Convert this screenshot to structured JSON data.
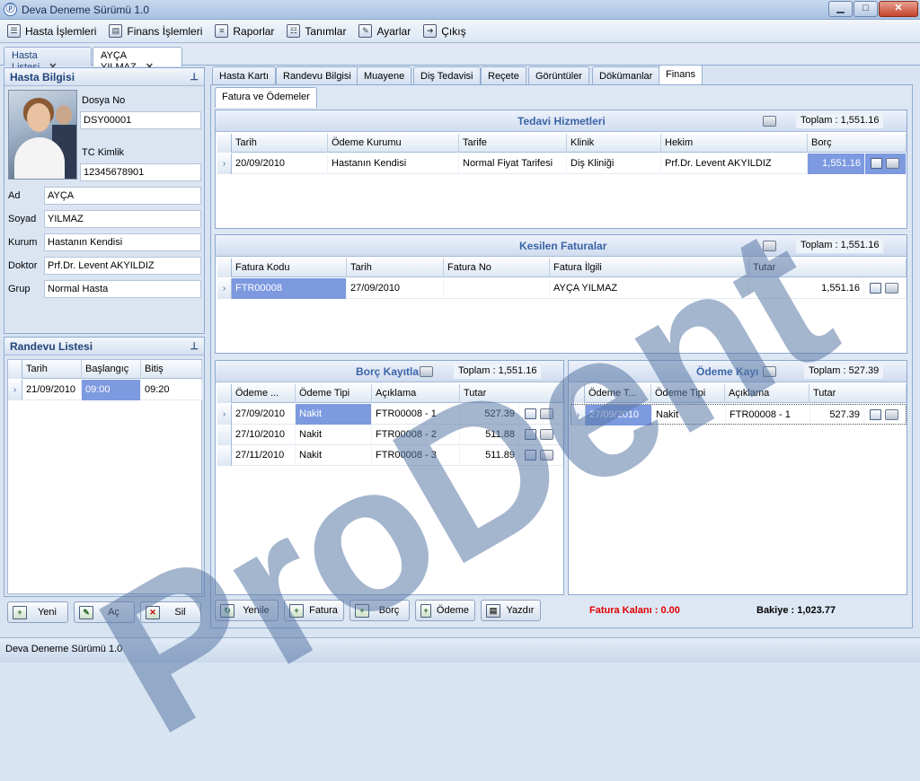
{
  "window": {
    "title": "Deva Deneme Sürümü 1.0",
    "minimize": "▁",
    "maximize": "□",
    "close": "✕"
  },
  "menu": [
    {
      "label": "Hasta İşlemleri",
      "icon": "patient-icon"
    },
    {
      "label": "Finans İşlemleri",
      "icon": "finance-icon"
    },
    {
      "label": "Raporlar",
      "icon": "report-icon"
    },
    {
      "label": "Tanımlar",
      "icon": "definitions-icon"
    },
    {
      "label": "Ayarlar",
      "icon": "settings-icon"
    },
    {
      "label": "Çıkış",
      "icon": "exit-icon"
    }
  ],
  "doc_tabs": [
    {
      "label": "Hasta Listesi",
      "close": "✕"
    },
    {
      "label": "AYÇA YILMAZ",
      "close": "✕"
    }
  ],
  "patient": {
    "panel_title": "Hasta Bilgisi",
    "pin": "ᵖ",
    "dosya_label": "Dosya No",
    "dosya": "DSY00001",
    "tc_label": "TC Kimlik",
    "tc": "12345678901",
    "ad_label": "Ad",
    "ad": "AYÇA",
    "soyad_label": "Soyad",
    "soyad": "YILMAZ",
    "kurum_label": "Kurum",
    "kurum": "Hastanın Kendisi",
    "doktor_label": "Doktor",
    "doktor": "Prf.Dr. Levent AKYILDIZ",
    "grup_label": "Grup",
    "grup": "Normal Hasta"
  },
  "appointments": {
    "panel_title": "Randevu Listesi",
    "pin": "ᵖ",
    "columns": [
      "Tarih",
      "Başlangıç",
      "Bitiş"
    ],
    "rows": [
      [
        "21/09/2010",
        "09:00",
        "09:20"
      ]
    ]
  },
  "left_buttons": [
    "Yeni",
    "Aç",
    "Sil"
  ],
  "sub_tabs": [
    "Hasta Kartı",
    "Randevu Bilgisi",
    "Muayene",
    "Diş Tedavisi",
    "Reçete",
    "Görüntüler",
    "Dökümanlar",
    "Finans"
  ],
  "inner_tab": "Fatura ve Ödemeler",
  "treatments": {
    "title": "Tedavi Hizmetleri",
    "total": "Toplam : 1,551.16",
    "columns": [
      "Tarih",
      "Ödeme Kurumu",
      "Tarife",
      "Klinik",
      "Hekim",
      "Borç"
    ],
    "rows": [
      [
        "20/09/2010",
        "Hastanın Kendisi",
        "Normal Fiyat Tarifesi",
        "Diş Kliniği",
        "Prf.Dr. Levent AKYILDIZ",
        "1,551.16"
      ]
    ]
  },
  "invoices": {
    "title": "Kesilen Faturalar",
    "total": "Toplam : 1,551.16",
    "columns": [
      "Fatura Kodu",
      "Tarih",
      "Fatura No",
      "Fatura İlgili",
      "Tutar"
    ],
    "rows": [
      [
        "FTR00008",
        "27/09/2010",
        "",
        "AYÇA YILMAZ",
        "1,551.16"
      ]
    ]
  },
  "debts": {
    "title": "Borç Kayıtla",
    "total": "Toplam : 1,551.16",
    "columns": [
      "Ödeme ...",
      "Ödeme Tipi",
      "Açıklama",
      "Tutar"
    ],
    "rows": [
      [
        "27/09/2010",
        "Nakit",
        "FTR00008 - 1",
        "527.39"
      ],
      [
        "27/10/2010",
        "Nakit",
        "FTR00008 - 2",
        "511.88"
      ],
      [
        "27/11/2010",
        "Nakit",
        "FTR00008 - 3",
        "511.89"
      ]
    ]
  },
  "payments": {
    "title": "Ödeme Kayı",
    "total": "Toplam : 527.39",
    "columns": [
      "Ödeme T...",
      "Ödeme Tipi",
      "Açıklama",
      "Tutar"
    ],
    "rows": [
      [
        "27/09/2010",
        "Nakit",
        "FTR00008 - 1",
        "527.39"
      ]
    ]
  },
  "bottom_buttons": [
    "Yenile",
    "Fatura",
    "Borç",
    "Ödeme",
    "Yazdır"
  ],
  "summary": {
    "fatura_kalani": "Fatura Kalanı : 0.00",
    "bakiye": "Bakiye : 1,023.77"
  },
  "status": {
    "text": "Deva Deneme Sürümü 1.0"
  },
  "watermark": "ProDent",
  "colors": {
    "accent": "#3b64a8",
    "selection": "#7d9ae0",
    "alert": "#e00000"
  }
}
